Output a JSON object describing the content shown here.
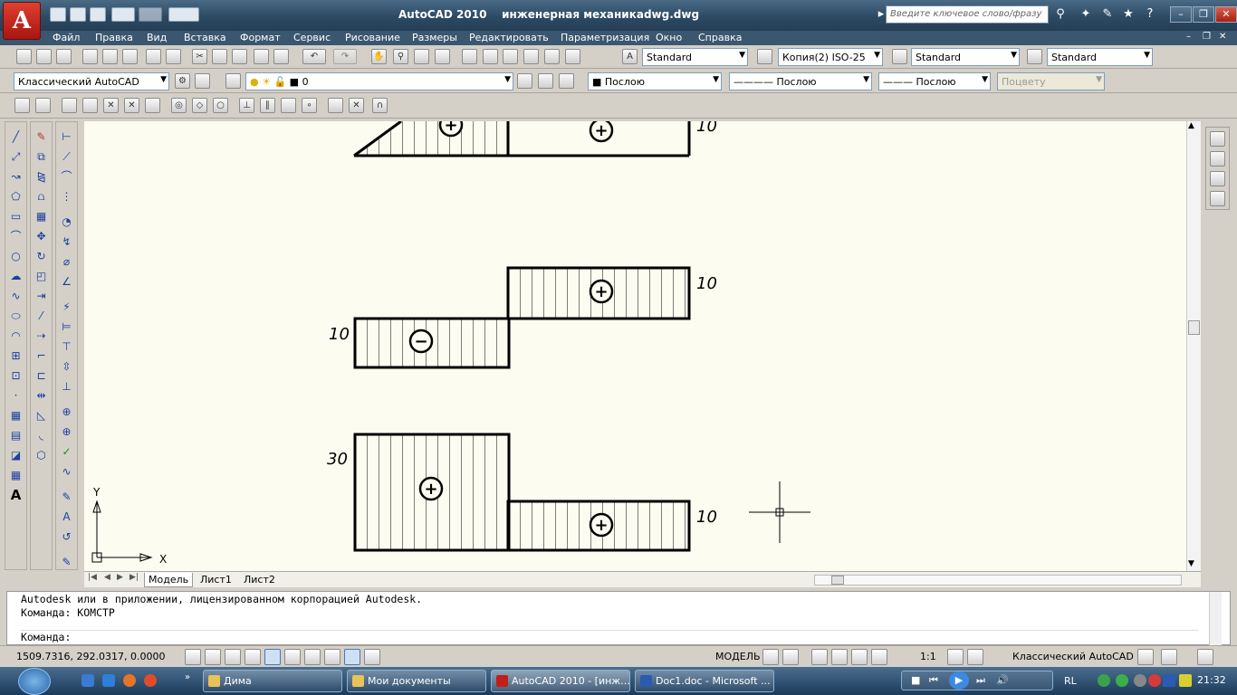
{
  "title_bar": {
    "app_button": "A",
    "title": "AutoCAD 2010    инженерная механикаdwg.dwg",
    "search_placeholder": "Введите ключевое слово/фразу"
  },
  "menu": [
    "Файл",
    "Правка",
    "Вид",
    "Вставка",
    "Формат",
    "Сервис",
    "Рисование",
    "Размеры",
    "Редактировать",
    "Параметризация",
    "Окно",
    "Справка"
  ],
  "toolbar_styles": {
    "text_style": "Standard",
    "dim_style": "Копия(2) ISO-25",
    "table_style": "Standard",
    "mleader_style": "Standard"
  },
  "toolbar_layers": {
    "workspace": "Классический AutoCAD",
    "layer": "0",
    "color": "Послою",
    "linetype": "Послою",
    "lineweight": "Послою",
    "plotstyle": "Поцвету"
  },
  "drawing": {
    "diagram1_label": "10",
    "diagram2_label_right": "10",
    "diagram2_label_left": "10",
    "diagram3_label_left": "30",
    "diagram3_label_right": "10",
    "sign_plus": "+",
    "sign_minus": "−",
    "ucs_x": "X",
    "ucs_y": "Y"
  },
  "tabs": [
    "Модель",
    "Лист1",
    "Лист2"
  ],
  "command_line": {
    "line1": "Autodesk или в приложении, лицензированном корпорацией Autodesk.",
    "line2": "Команда: КОМСТР",
    "prompt": "Команда:"
  },
  "status_bar": {
    "coords": "1509.7316, 292.0317, 0.0000",
    "model": "МОДЕЛЬ",
    "scale": "1:1",
    "workspace": "Классический AutoCAD"
  },
  "taskbar": {
    "items": [
      "Дима",
      "Мои документы",
      "AutoCAD 2010 - [инж...",
      "Doc1.doc - Microsoft ..."
    ],
    "lang": "RL",
    "time": "21:32"
  }
}
